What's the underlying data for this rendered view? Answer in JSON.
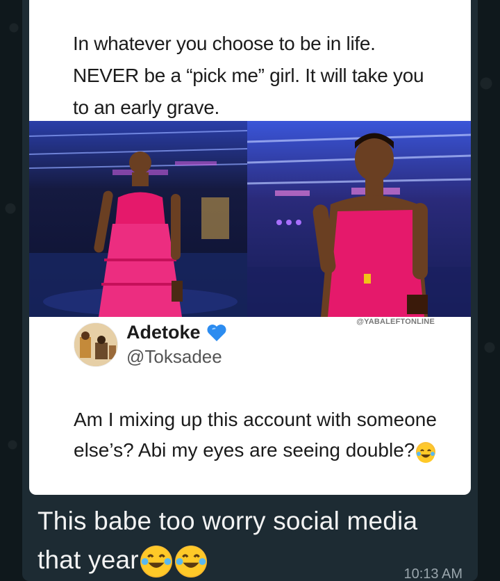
{
  "tweet": {
    "text": "In whatever you choose to be in life. NEVER be a “pick me” girl. It will take you to an early grave.",
    "watermark": "@YABALEFTONLINE"
  },
  "reply": {
    "display_name": "Adetoke",
    "handle": "@Toksadee",
    "text": "Am I mixing up this account with someone else’s? Abi my eyes are seeing double?",
    "verified_icon": "blue-heart-icon",
    "trailing_emoji": "laughing-tears-emoji"
  },
  "message": {
    "caption": "This babe too worry social media that year",
    "trailing_emojis": [
      "laughing-tears-emoji",
      "laughing-tears-emoji"
    ],
    "time": "10:13 AM"
  },
  "colors": {
    "chat_bg": "#0f181c",
    "bubble": "#1d2b33",
    "dress_pink": "#e5196b",
    "heart_blue": "#2c8cf0"
  }
}
